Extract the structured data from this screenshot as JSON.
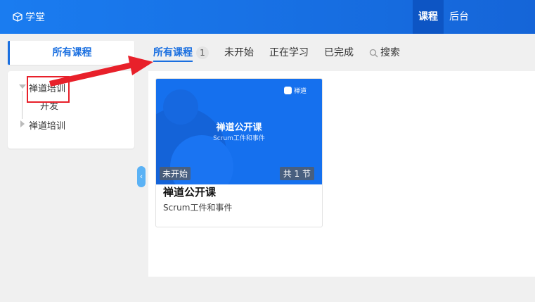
{
  "header": {
    "app_name": "学堂",
    "nav": [
      {
        "label": "课程",
        "active": true
      },
      {
        "label": "后台",
        "active": false
      }
    ]
  },
  "sidebar": {
    "tab_label": "所有课程",
    "tree": [
      {
        "label": "禅道培训",
        "expanded": true,
        "children": [
          {
            "label": "开发"
          }
        ]
      },
      {
        "label": "禅道培训",
        "expanded": false
      }
    ]
  },
  "tabs": [
    {
      "label": "所有课程",
      "count": "1",
      "active": true
    },
    {
      "label": "未开始",
      "active": false
    },
    {
      "label": "正在学习",
      "active": false
    },
    {
      "label": "已完成",
      "active": false
    }
  ],
  "search_label": "搜索",
  "courses": [
    {
      "cover_title": "禅道公开课",
      "cover_subtitle": "Scrum工件和事件",
      "cover_logo_text": "禅道",
      "status": "未开始",
      "lesson_count": "共 1 节",
      "title": "禅道公开课",
      "description": "Scrum工件和事件"
    }
  ],
  "colors": {
    "header": "#1a7cf0",
    "accent": "#1a6fe0",
    "annotation": "#e8202a"
  }
}
